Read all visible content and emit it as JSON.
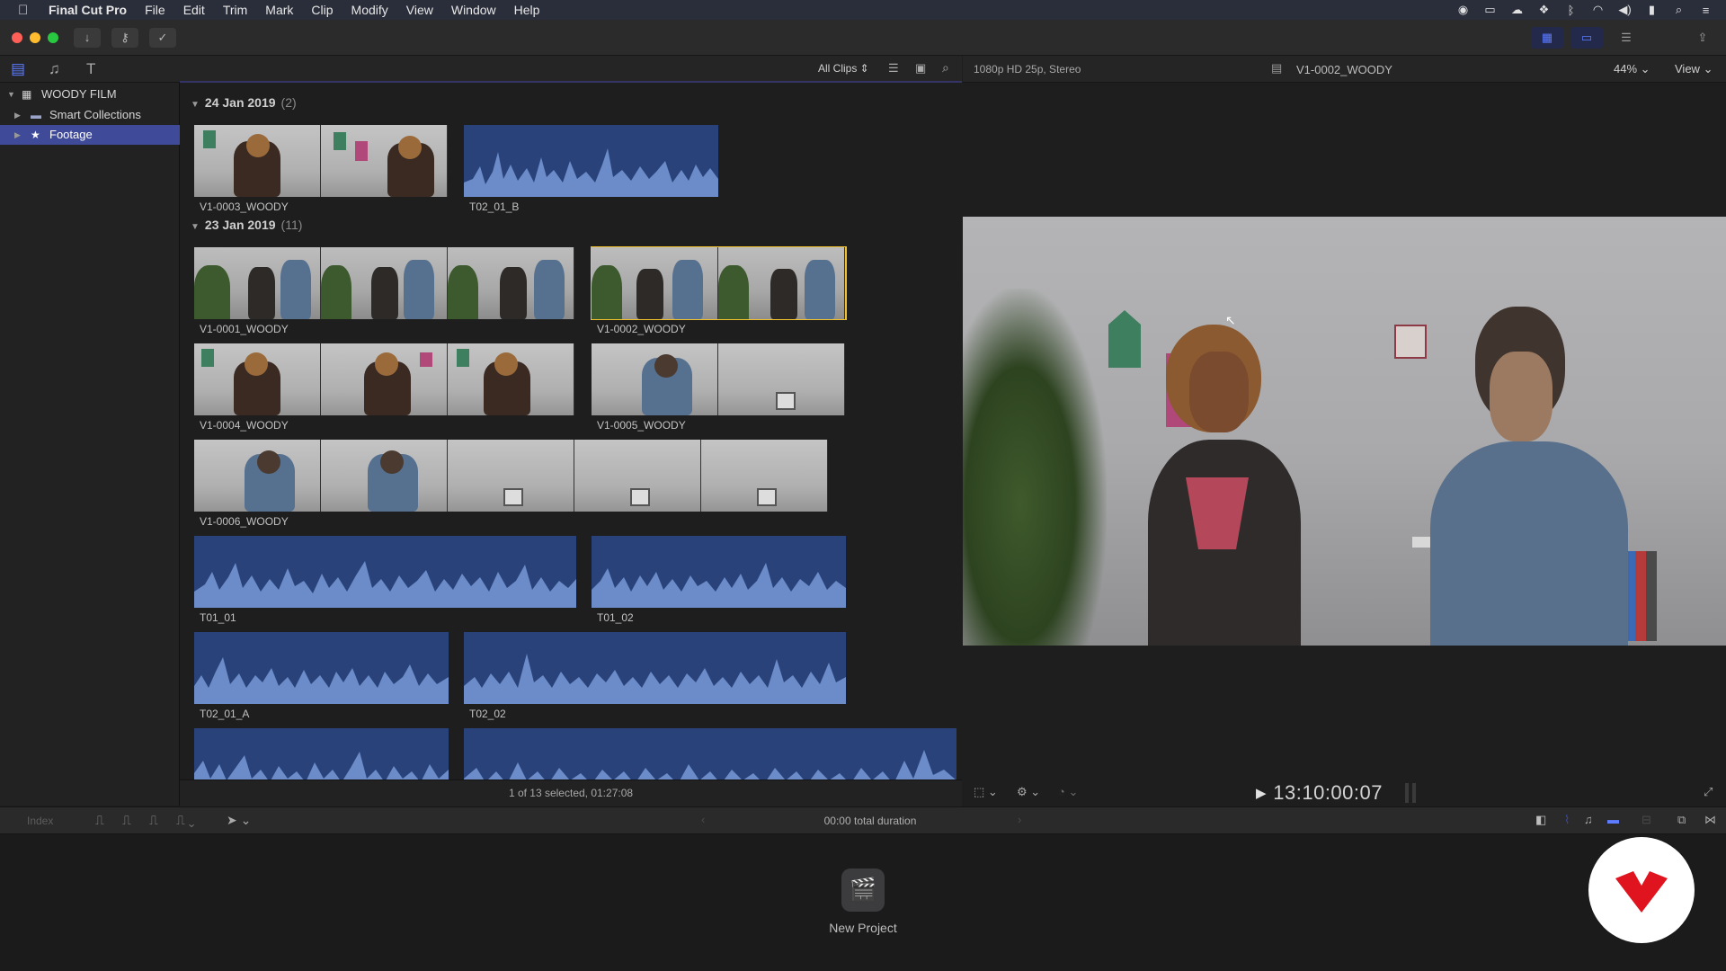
{
  "menubar": {
    "apple": "",
    "app_name": "Final Cut Pro",
    "items": [
      "File",
      "Edit",
      "Trim",
      "Mark",
      "Clip",
      "Modify",
      "View",
      "Window",
      "Help"
    ],
    "status_icons": [
      "record-icon",
      "display-icon",
      "creative-cloud-icon",
      "dropbox-icon",
      "bluetooth-icon",
      "wifi-icon",
      "volume-icon",
      "battery-icon",
      "spotlight-icon",
      "notification-center-icon"
    ]
  },
  "toolbar": {
    "import_icon": "↓",
    "keywords_icon": "⌐",
    "background_tasks_icon": "✓",
    "accent": "#3b5bd9"
  },
  "sidebar": {
    "library": "WOODY FILM",
    "items": [
      {
        "label": "Smart Collections"
      },
      {
        "label": "Footage"
      }
    ]
  },
  "browser": {
    "filter": "All Clips",
    "groups": [
      {
        "date": "24 Jan 2019",
        "count": "(2)"
      },
      {
        "date": "23 Jan 2019",
        "count": "(11)"
      }
    ],
    "clips": [
      {
        "name": "V1-0003_WOODY"
      },
      {
        "name": "T02_01_B"
      },
      {
        "name": "V1-0001_WOODY"
      },
      {
        "name": "V1-0002_WOODY"
      },
      {
        "name": "V1-0004_WOODY"
      },
      {
        "name": "V1-0005_WOODY"
      },
      {
        "name": "V1-0006_WOODY"
      },
      {
        "name": "T01_01"
      },
      {
        "name": "T01_02"
      },
      {
        "name": "T02_01_A"
      },
      {
        "name": "T02_02"
      }
    ],
    "status": "1 of 13 selected, 01:27:08"
  },
  "viewer": {
    "format": "1080p HD 25p, Stereo",
    "clip_name": "V1-0002_WOODY",
    "zoom": "44%",
    "view_label": "View",
    "timecode": "13:10:00:07"
  },
  "timeline": {
    "index_label": "Index",
    "duration": "00:00 total duration",
    "new_project": "New Project"
  },
  "colors": {
    "selection": "#f2c12e",
    "sidebar_selected": "#3f4a99",
    "audio_bg": "#29437a",
    "audio_wave": "#6b8cc9",
    "badge_red": "#e0141e"
  }
}
